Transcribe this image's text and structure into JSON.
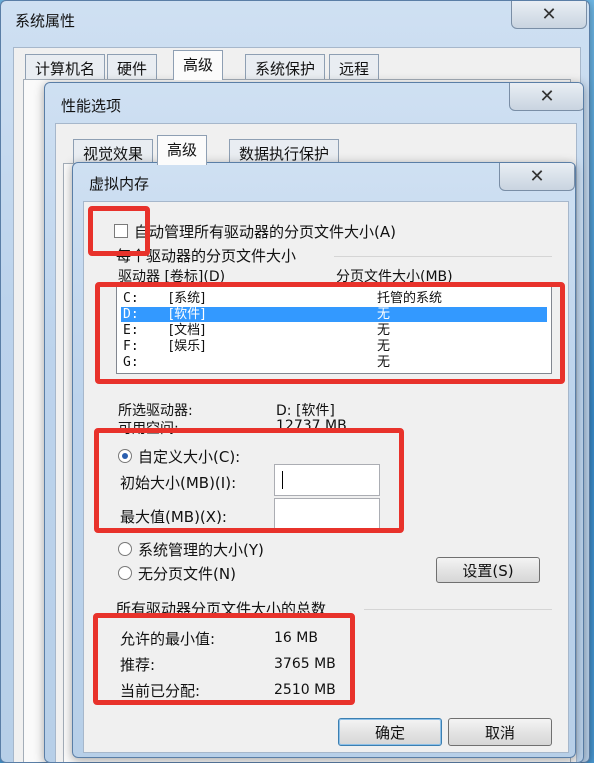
{
  "system_properties": {
    "title": "系统属性",
    "tabs": [
      "计算机名",
      "硬件",
      "高级",
      "系统保护",
      "远程"
    ],
    "active_tab": 2
  },
  "performance_options": {
    "title": "性能选项",
    "tabs": [
      "视觉效果",
      "高级",
      "数据执行保护"
    ],
    "active_tab": 1
  },
  "virtual_memory": {
    "title": "虚拟内存",
    "auto_manage_label": "自动管理所有驱动器的分页文件大小(A)",
    "auto_manage_checked": false,
    "group_label": "每个驱动器的分页文件大小",
    "col_drive": "驱动器 [卷标](D)",
    "col_size": "分页文件大小(MB)",
    "drives": [
      {
        "drive": "C:",
        "label": "[系统]",
        "size": "托管的系统"
      },
      {
        "drive": "D:",
        "label": "[软件]",
        "size": "无"
      },
      {
        "drive": "E:",
        "label": "[文档]",
        "size": "无"
      },
      {
        "drive": "F:",
        "label": "[娱乐]",
        "size": "无"
      },
      {
        "drive": "G:",
        "label": "",
        "size": "无"
      }
    ],
    "selected_index": 1,
    "selected_drive_label": "所选驱动器:",
    "selected_drive_value": "D:  [软件]",
    "available_space_label": "可用空间:",
    "available_space_value": "12737 MB",
    "custom_size_label": "自定义大小(C):",
    "initial_size_label": "初始大小(MB)(I):",
    "initial_size_value": "",
    "max_size_label": "最大值(MB)(X):",
    "max_size_value": "",
    "system_managed_label": "系统管理的大小(Y)",
    "no_paging_label": "无分页文件(N)",
    "set_button": "设置(S)",
    "selected_option": "custom",
    "totals_group_label": "所有驱动器分页文件大小的总数",
    "min_allowed_label": "允许的最小值:",
    "min_allowed_value": "16 MB",
    "recommended_label": "推荐:",
    "recommended_value": "3765 MB",
    "current_label": "当前已分配:",
    "current_value": "2510 MB",
    "ok_button": "确定",
    "cancel_button": "取消"
  },
  "icons": {
    "close": "close-icon",
    "check": "checkbox",
    "radio": "radio-button"
  },
  "colors": {
    "selection": "#3399ff",
    "annotation": "#e8322b"
  }
}
